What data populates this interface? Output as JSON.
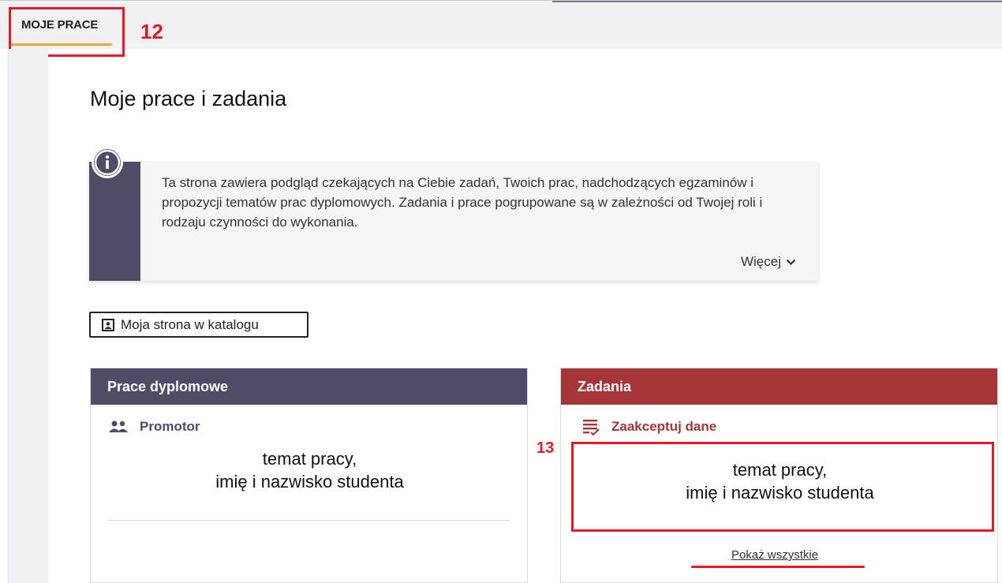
{
  "top_tab": {
    "label": "MOJE PRACE"
  },
  "annotations": {
    "tab_marker": "12",
    "task_marker": "13"
  },
  "page": {
    "title": "Moje prace i zadania"
  },
  "info": {
    "text": "Ta strona zawiera podgląd czekających na Ciebie zadań, Twoich prac, nadchodzących egzaminów i propozycji tematów prac dyplomowych. Zadania i prace pogrupowane są w zależności od Twojej roli i rodzaju czynności do wykonania.",
    "more_label": "Więcej"
  },
  "catalog_button": {
    "label": "Moja strona w katalogu"
  },
  "cards": {
    "theses": {
      "title": "Prace dyplomowe",
      "role_label": "Promotor",
      "entry_line1": "temat pracy,",
      "entry_line2": "imię i nazwisko studenta"
    },
    "tasks": {
      "title": "Zadania",
      "action_label": "Zaakceptuj dane",
      "entry_line1": "temat pracy,",
      "entry_line2": "imię i nazwisko studenta",
      "show_all_label": "Pokaż wszystkie"
    }
  },
  "colors": {
    "accent_dark": "#4e4c66",
    "accent_red": "#a63538",
    "tab_underline": "#f0a535",
    "annotation": "#e11a24"
  }
}
